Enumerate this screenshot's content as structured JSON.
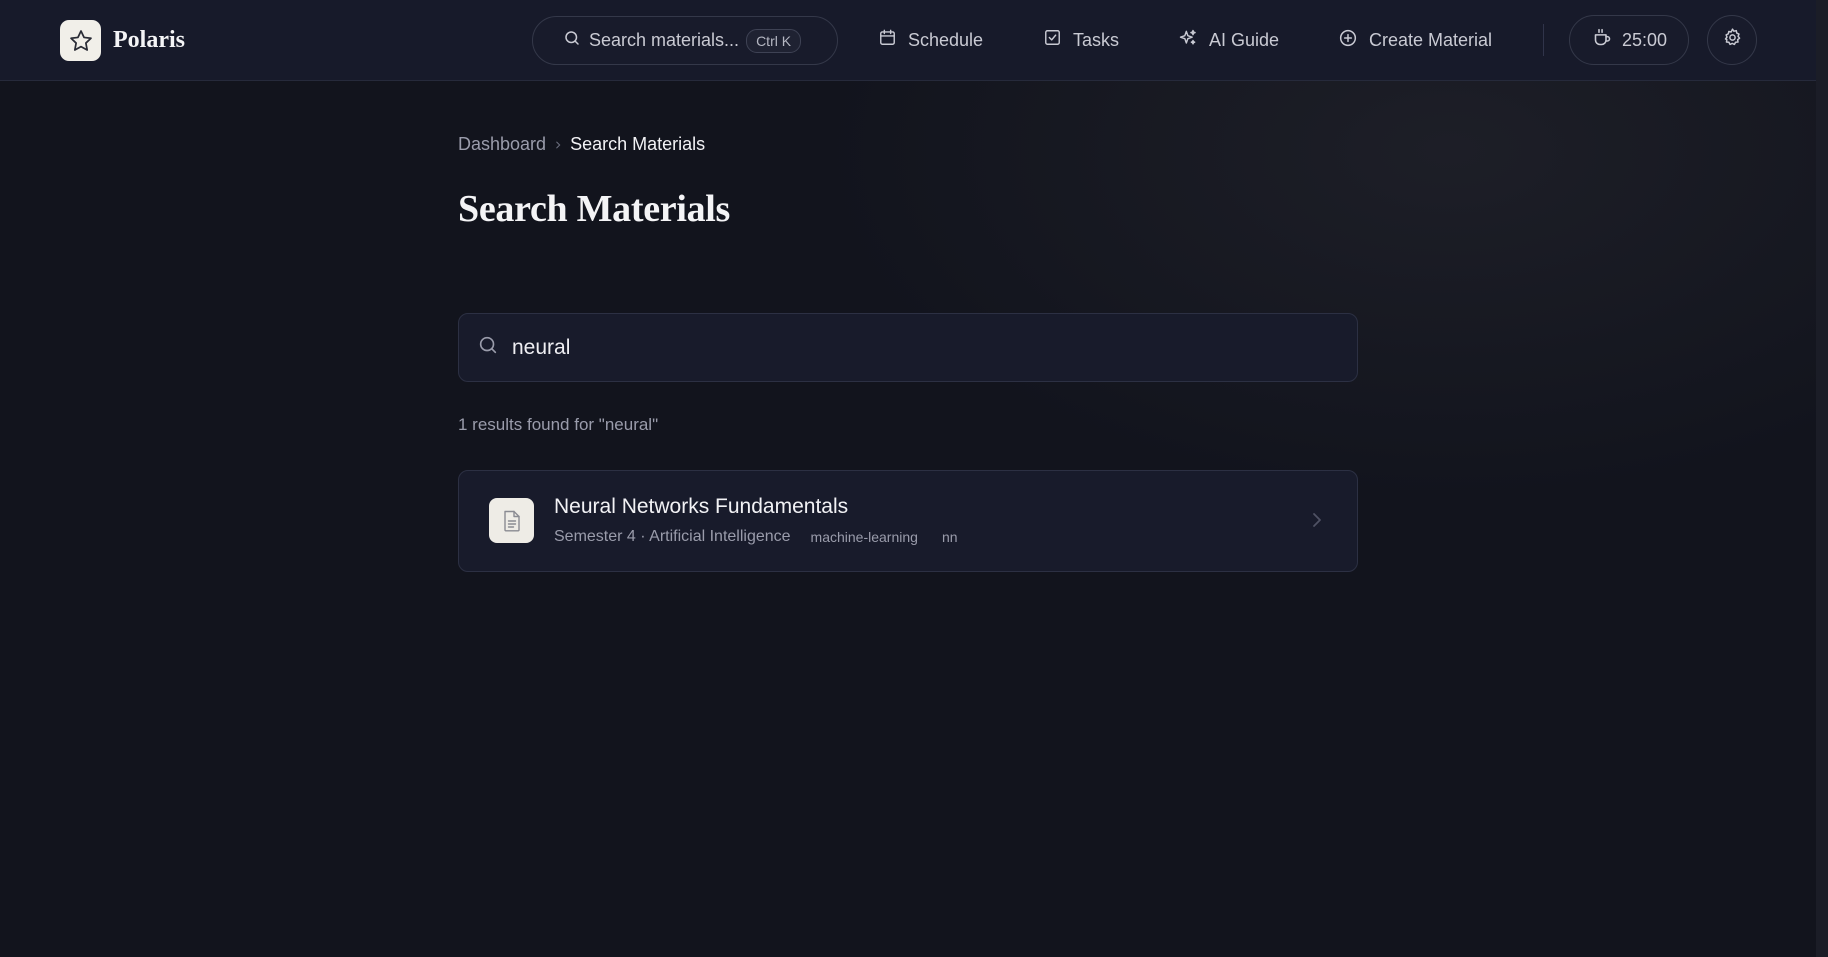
{
  "app": {
    "name": "Polaris"
  },
  "header": {
    "search": {
      "label": "Search materials...",
      "shortcut": "Ctrl K"
    },
    "nav": [
      {
        "label": "Schedule",
        "icon": "calendar-icon"
      },
      {
        "label": "Tasks",
        "icon": "checkbox-icon"
      },
      {
        "label": "AI Guide",
        "icon": "sparkles-icon"
      },
      {
        "label": "Create Material",
        "icon": "plus-circle-icon"
      }
    ],
    "timer": {
      "value": "25:00",
      "icon": "coffee-icon"
    },
    "settings_icon": "gear-icon"
  },
  "breadcrumb": {
    "root": "Dashboard",
    "current": "Search Materials"
  },
  "page": {
    "title": "Search Materials"
  },
  "search": {
    "query": "neural"
  },
  "results": {
    "summary": "1 results found for \"neural\"",
    "items": [
      {
        "title": "Neural Networks Fundamentals",
        "subtitle": "Semester 4 · Artificial Intelligence",
        "tags": [
          "machine-learning",
          "nn"
        ],
        "icon": "document-icon"
      }
    ]
  },
  "colors": {
    "background": "#12141d",
    "header": "#171a2a",
    "surface": "#181b2b",
    "border": "#2c3043",
    "logo_tile": "#f1efe9"
  }
}
